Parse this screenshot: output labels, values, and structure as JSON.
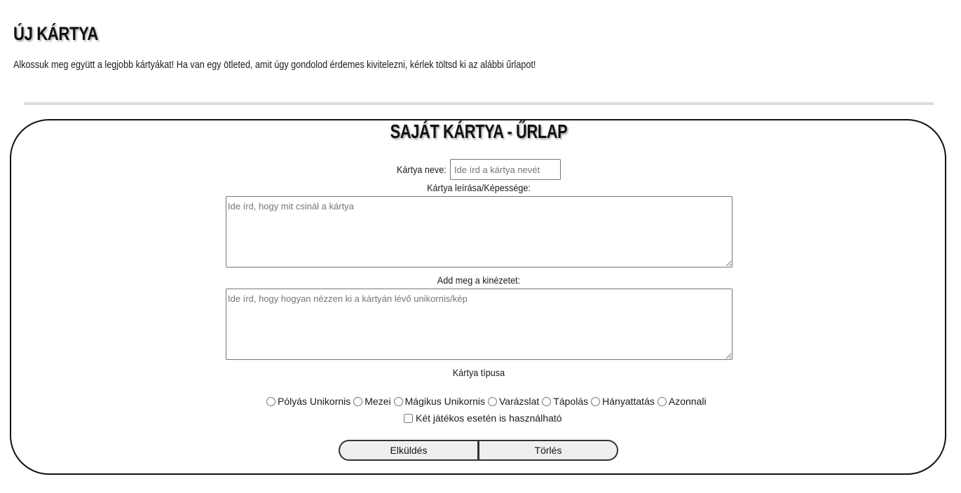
{
  "header": {
    "title": "ÚJ KÁRTYA",
    "intro": "Alkossuk meg együtt a legjobb kártyákat! Ha van egy ötleted, amit úgy gondolod érdemes kivitelezni, kérlek töltsd ki az alábbi űrlapot!"
  },
  "form": {
    "title": "SAJÁT KÁRTYA - ŰRLAP",
    "name_label": "Kártya neve:",
    "name_placeholder": "Ide írd a kártya nevét",
    "name_value": "",
    "description_label": "Kártya leírása/Képessége:",
    "description_placeholder": "Ide írd, hogy mit csinál a kártya",
    "appearance_label": "Add meg a kinézetet:",
    "appearance_placeholder": "Ide írd, hogy hogyan nézzen ki a kártyán lévő unikornis/kép",
    "type_label": "Kártya típusa",
    "types": [
      "Pólyás Unikornis",
      "Mezei",
      "Mágikus Unikornis",
      "Varázslat",
      "Tápolás",
      "Hányattatás",
      "Azonnali"
    ],
    "two_player_label": "Két játékos esetén is használható",
    "submit_label": "Elküldés",
    "reset_label": "Törlés"
  }
}
